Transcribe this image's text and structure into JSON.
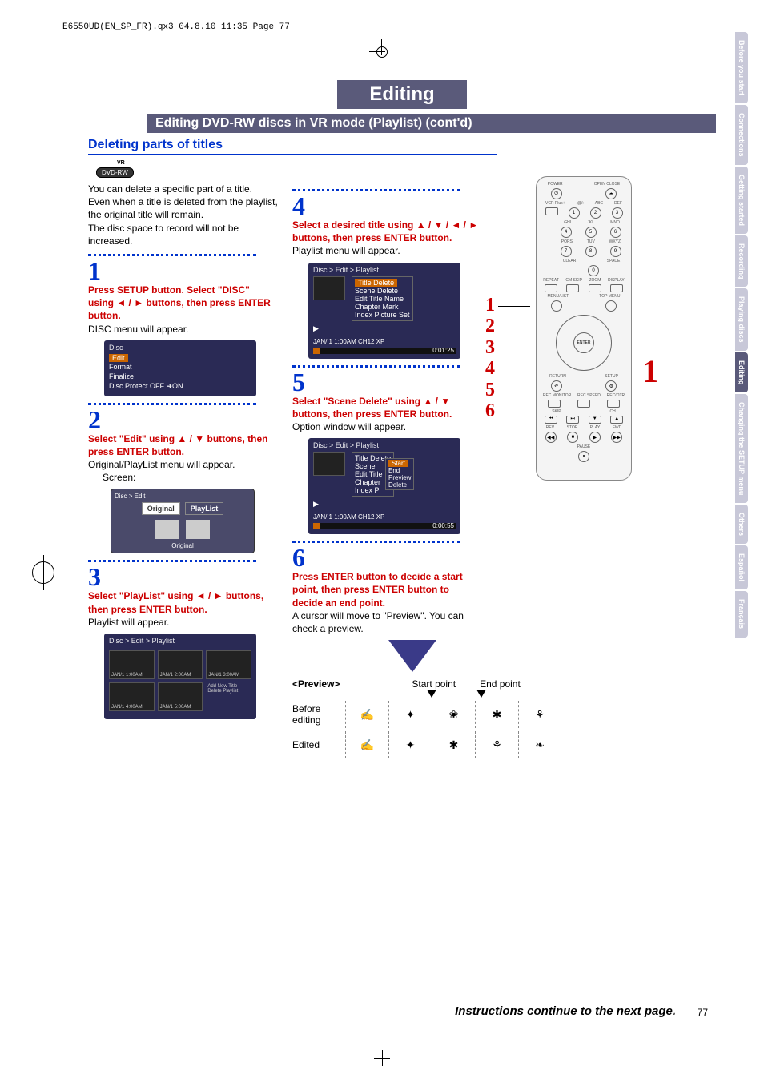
{
  "print_header": "E6550UD(EN_SP_FR).qx3  04.8.10  11:35  Page 77",
  "page_title": "Editing",
  "subtitle_bar": "Editing DVD-RW discs in VR mode (Playlist) (cont'd)",
  "section_heading": "Deleting parts of titles",
  "vr_label": "VR",
  "disc_icon": "DVD-RW",
  "intro_lines": [
    "You can delete a specific part of a title.",
    "Even when a title is deleted from the playlist, the original title will remain.",
    "The disc space to record will not be increased."
  ],
  "steps": {
    "s1": {
      "num": "1",
      "bold": "Press SETUP button. Select \"DISC\" using ◄ / ► buttons, then press ENTER button.",
      "text": "DISC menu will appear."
    },
    "s2": {
      "num": "2",
      "bold": "Select \"Edit\" using ▲ / ▼ buttons, then press ENTER button.",
      "text": "Original/PlayList menu will appear.",
      "text2": "Screen:"
    },
    "s3": {
      "num": "3",
      "bold": "Select \"PlayList\" using ◄ / ► buttons, then press ENTER button.",
      "text": "Playlist will appear."
    },
    "s4": {
      "num": "4",
      "bold": "Select a desired title using ▲ / ▼ / ◄ / ► buttons, then press ENTER button.",
      "text": "Playlist menu will appear."
    },
    "s5": {
      "num": "5",
      "bold": "Select \"Scene Delete\" using ▲ / ▼ buttons, then press ENTER button.",
      "text": "Option window will appear."
    },
    "s6": {
      "num": "6",
      "bold": "Press ENTER button to decide a start point, then press ENTER button to decide an end point.",
      "text": "A cursor will move to \"Preview\". You can check a preview."
    }
  },
  "osd_disc": {
    "title": "Disc",
    "items": [
      "Edit",
      "Format",
      "Finalize",
      "Disc Protect OFF ➜ON"
    ]
  },
  "osd_edit": {
    "breadcrumb": "Disc > Edit",
    "tabs": [
      "Original",
      "PlayList"
    ],
    "footer": "Original"
  },
  "osd_playlist": {
    "breadcrumb": "Disc > Edit > Playlist",
    "cells": [
      "JAN/1  1:00AM",
      "JAN/1  2:00AM",
      "JAN/1  3:00AM",
      "JAN/1  4:00AM",
      "JAN/1  5:00AM"
    ],
    "addnew": "Add New Title Delete Playlist"
  },
  "osd_titlemenu": {
    "breadcrumb": "Disc > Edit > Playlist",
    "items": [
      "Title Delete",
      "Scene Delete",
      "Edit Title Name",
      "Chapter Mark",
      "Index Picture Set"
    ],
    "foot": "JAN/ 1   1:00AM  CH12      XP",
    "time": "0:01:25"
  },
  "osd_scene": {
    "breadcrumb": "Disc > Edit > Playlist",
    "items": [
      "Title Delete",
      "Scene",
      "Edit Title",
      "Chapter",
      "Index P"
    ],
    "sub": [
      "Start",
      "End",
      "Preview",
      "Delete"
    ],
    "foot": "JAN/ 1   1:00AM  CH12      XP",
    "time": "0:00:55"
  },
  "preview": {
    "label": "<Preview>",
    "start": "Start point",
    "end": "End point",
    "before": "Before editing",
    "edited": "Edited"
  },
  "remote": {
    "top_labels": [
      "POWER",
      "OPEN CLOSE"
    ],
    "keypad_labels": [
      ".@/:",
      "ABC",
      "DEF",
      "GHI",
      "JKL",
      "MNO",
      "PQRS",
      "TUV",
      "WXYZ",
      "CLEAR",
      "",
      "SPACE"
    ],
    "keypad": [
      "1",
      "2",
      "3",
      "4",
      "5",
      "6",
      "7",
      "8",
      "9",
      "",
      "0",
      ""
    ],
    "mid_labels": [
      "REPEAT",
      "CM SKIP",
      "ZOOM",
      "DISPLAY"
    ],
    "menu_left": "MENU/LIST",
    "menu_right": "TOP MENU",
    "enter": "ENTER",
    "return": "RETURN",
    "setup": "SETUP",
    "rec_labels": [
      "REC MONITOR",
      "REC SPEED",
      "REC/OTR"
    ],
    "skip": "SKIP",
    "ch": "CH",
    "transport": [
      "REV",
      "STOP",
      "PLAY",
      "FWD"
    ],
    "pause": "PAUSE"
  },
  "step_callouts": [
    "1",
    "2",
    "3",
    "4",
    "5",
    "6"
  ],
  "big_red": "1",
  "side_tabs": [
    "Before you start",
    "Connections",
    "Getting started",
    "Recording",
    "Playing discs",
    "Editing",
    "Changing the SETUP menu",
    "Others",
    "Español",
    "Français"
  ],
  "side_active_index": 5,
  "footer_note": "Instructions continue to the next page.",
  "page_num": "77"
}
